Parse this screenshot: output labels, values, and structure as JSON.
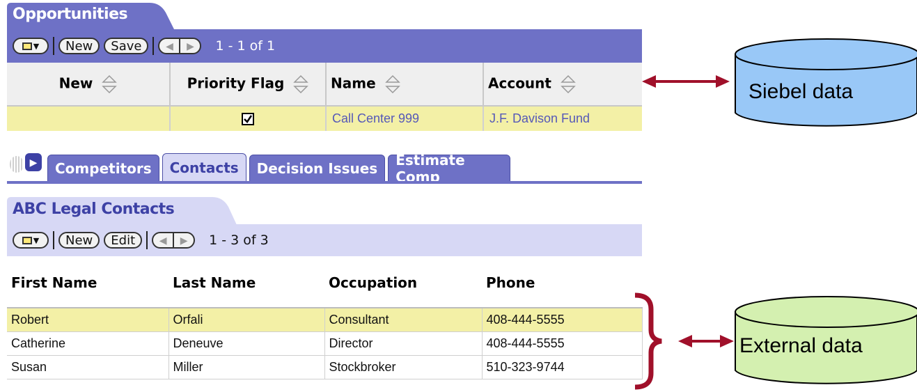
{
  "opportunities": {
    "title": "Opportunities",
    "toolbar": {
      "new_label": "New",
      "save_label": "Save",
      "record_count": "1 - 1 of 1"
    },
    "columns": [
      "New",
      "Priority Flag",
      "Name",
      "Account"
    ],
    "row": {
      "new": "",
      "priority_flag_checked": true,
      "name": "Call Center 999",
      "account": "J.F. Davison Fund"
    }
  },
  "view_tabs": {
    "items": [
      "Competitors",
      "Contacts",
      "Decision Issues",
      "Estimate Comp"
    ],
    "active": "Contacts"
  },
  "contacts": {
    "title": "ABC Legal Contacts",
    "toolbar": {
      "new_label": "New",
      "edit_label": "Edit",
      "record_count": "1 - 3 of 3"
    },
    "columns": [
      "First Name",
      "Last Name",
      "Occupation",
      "Phone"
    ],
    "rows": [
      [
        "Robert",
        "Orfali",
        "Consultant",
        "408-444-5555"
      ],
      [
        "Catherine",
        "Deneuve",
        "Director",
        "408-444-5555"
      ],
      [
        "Susan",
        "Miller",
        "Stockbroker",
        "510-323-9744"
      ]
    ]
  },
  "annotations": {
    "siebel_label": "Siebel data",
    "external_label": "External data",
    "arrow_color": "#a0102a",
    "siebel_color": "#99c8f7",
    "external_color": "#d4f0b0"
  },
  "colors": {
    "header_bar": "#6e71c6",
    "header_bar_light": "#d7d8f5",
    "selected_row": "#f3f0a6"
  }
}
